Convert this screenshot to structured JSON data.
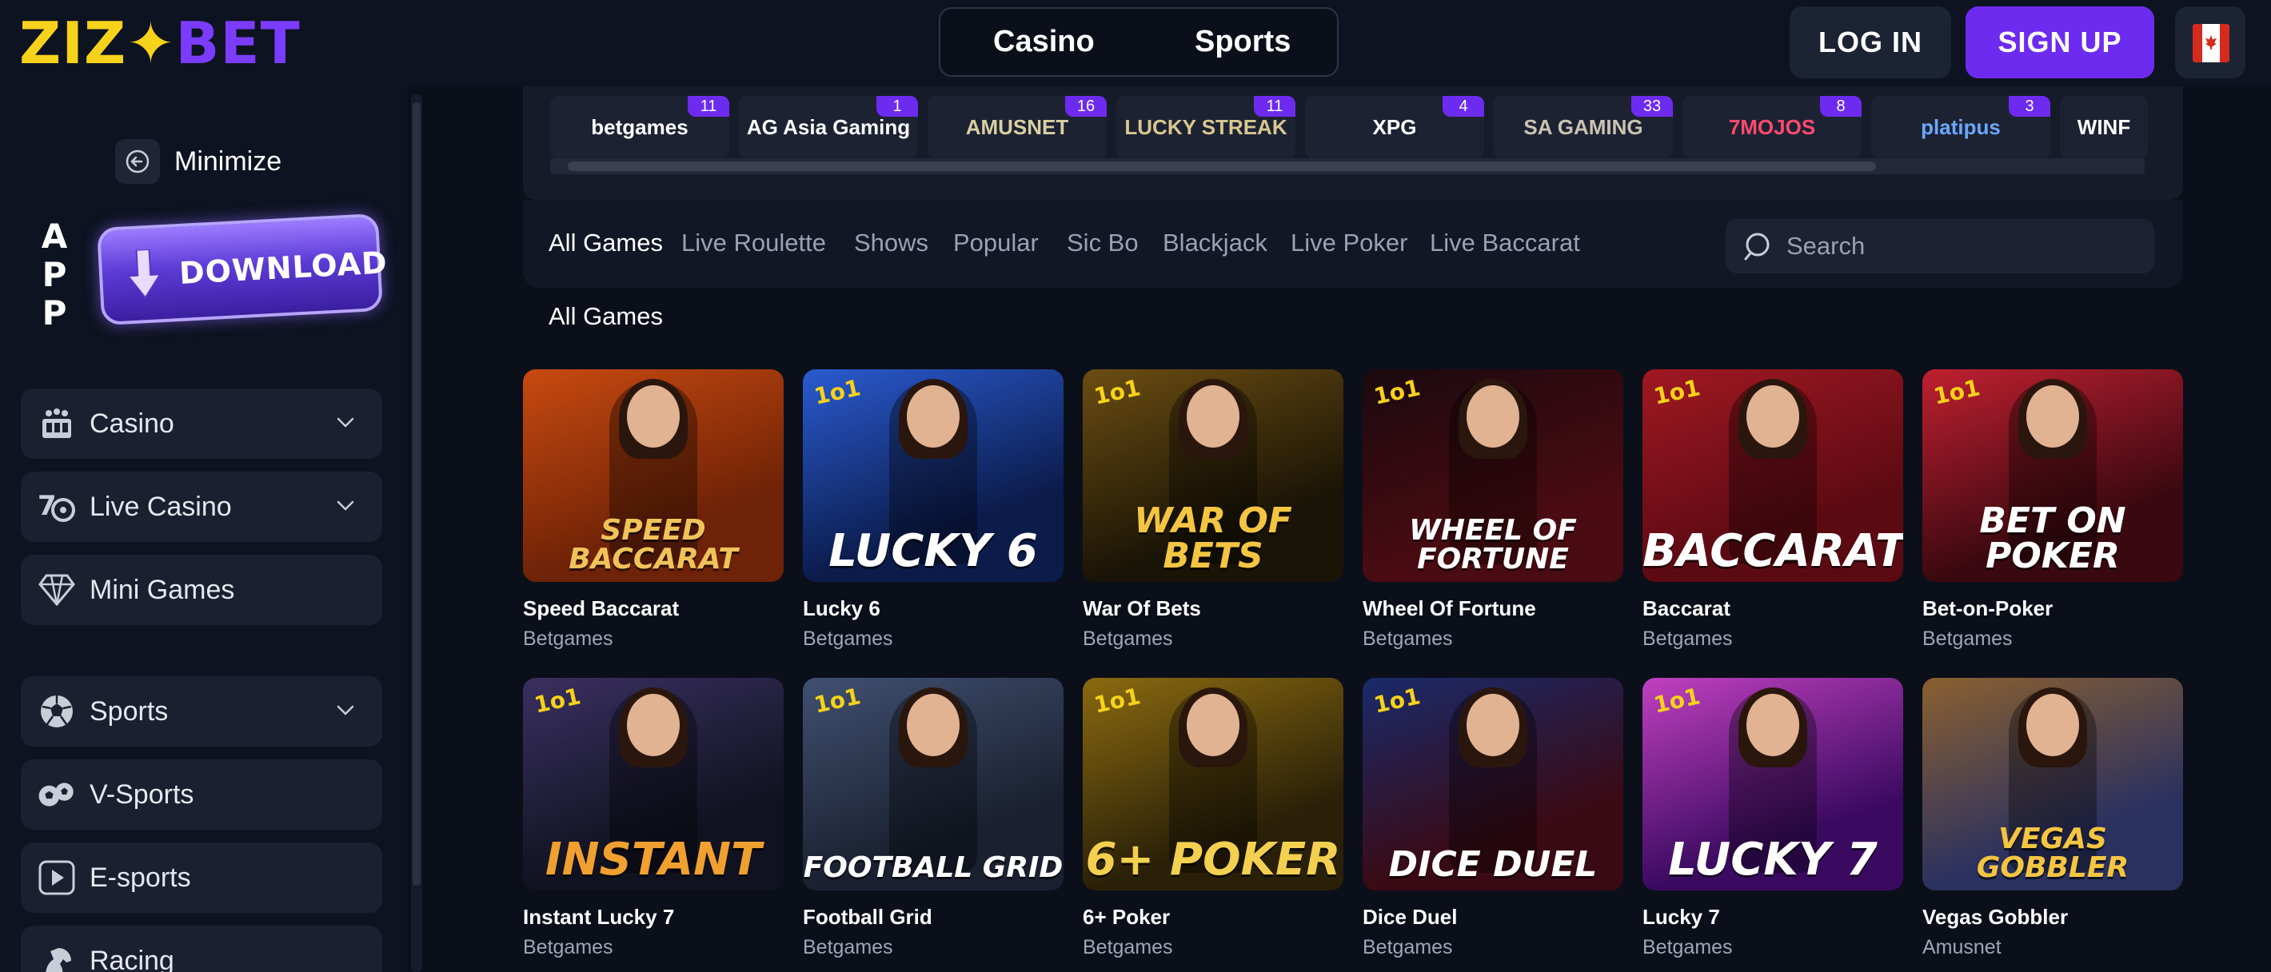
{
  "header": {
    "logo": {
      "part1": "ZIZ",
      "star": "✦",
      "part2": "BET"
    },
    "toggle": {
      "casino": "Casino",
      "sports": "Sports"
    },
    "login": "LOG IN",
    "signup": "SIGN UP",
    "flag_icon": "canada-flag-icon"
  },
  "sidebar": {
    "minimize": "Minimize",
    "app_letters": [
      "A",
      "P",
      "P"
    ],
    "download": "DOWNLOAD",
    "items": [
      {
        "label": "Casino",
        "icon": "casino-icon",
        "has_chevron": true
      },
      {
        "label": "Live Casino",
        "icon": "live-casino-icon",
        "has_chevron": true
      },
      {
        "label": "Mini Games",
        "icon": "diamond-icon",
        "has_chevron": false
      },
      {
        "label": "Sports",
        "icon": "soccer-ball-icon",
        "has_chevron": true
      },
      {
        "label": "V-Sports",
        "icon": "v-sports-icon",
        "has_chevron": false
      },
      {
        "label": "E-sports",
        "icon": "play-icon",
        "has_chevron": false
      },
      {
        "label": "Racing",
        "icon": "horse-icon",
        "has_chevron": false
      }
    ]
  },
  "providers": [
    {
      "name": "betgames",
      "count": "11",
      "color": "#ffffff"
    },
    {
      "name": "AG Asia Gaming",
      "count": "1",
      "color": "#ffffff"
    },
    {
      "name": "AMUSNET",
      "count": "16",
      "color": "#d8d0a0"
    },
    {
      "name": "LUCKY STREAK",
      "count": "11",
      "color": "#d8c890"
    },
    {
      "name": "XPG",
      "count": "4",
      "color": "#ffffff"
    },
    {
      "name": "SA GAMING",
      "count": "33",
      "color": "#c9c4b0"
    },
    {
      "name": "7MOJOS",
      "count": "8",
      "color": "#ff4a6e"
    },
    {
      "name": "platipus",
      "count": "3",
      "color": "#6aa8ff"
    },
    {
      "name": "WINF",
      "count": "",
      "color": "#ffffff"
    }
  ],
  "tabs": [
    "All Games",
    "Live Roulette",
    "Shows",
    "Popular",
    "Sic Bo",
    "Blackjack",
    "Live Poker",
    "Live Baccarat"
  ],
  "search": {
    "placeholder": "Search"
  },
  "section_title": "All Games",
  "games": [
    {
      "title": "Speed Baccarat",
      "provider": "Betgames",
      "art": "SPEED BACCARAT",
      "bg": "#6e2207",
      "bg2": "#c84a10",
      "art_color": "#f0c35a"
    },
    {
      "title": "Lucky 6",
      "provider": "Betgames",
      "art": "LUCKY 6",
      "bg": "#0b1b4a",
      "bg2": "#2a5bd0",
      "art_color": "#ffffff"
    },
    {
      "title": "War Of Bets",
      "provider": "Betgames",
      "art": "WAR OF BETS",
      "bg": "#1a1406",
      "bg2": "#6b4d12",
      "art_color": "#f4c542"
    },
    {
      "title": "Wheel Of Fortune",
      "provider": "Betgames",
      "art": "WHEEL OF FORTUNE",
      "bg": "#4a0b12",
      "bg2": "#1a0a0f",
      "art_color": "#ffffff"
    },
    {
      "title": "Baccarat",
      "provider": "Betgames",
      "art": "BACCARAT",
      "bg": "#5c0a12",
      "bg2": "#a01822",
      "art_color": "#ffffff"
    },
    {
      "title": "Bet-on-Poker",
      "provider": "Betgames",
      "art": "BET ON POKER",
      "bg": "#3a0810",
      "bg2": "#c02030",
      "art_color": "#ffffff"
    },
    {
      "title": "Instant Lucky 7",
      "provider": "Betgames",
      "art": "INSTANT",
      "bg": "#101220",
      "bg2": "#3a3060",
      "art_color": "#f0a030"
    },
    {
      "title": "Football Grid",
      "provider": "Betgames",
      "art": "FOOTBALL GRID",
      "bg": "#1a2030",
      "bg2": "#405070",
      "art_color": "#ffffff"
    },
    {
      "title": "6+ Poker",
      "provider": "Betgames",
      "art": "6+ POKER",
      "bg": "#2a2008",
      "bg2": "#8a6a10",
      "art_color": "#f4d050"
    },
    {
      "title": "Dice Duel",
      "provider": "Betgames",
      "art": "DICE DUEL",
      "bg": "#3a0a14",
      "bg2": "#1a2a6a",
      "art_color": "#ffffff"
    },
    {
      "title": "Lucky 7",
      "provider": "Betgames",
      "art": "LUCKY 7",
      "bg": "#3a0a60",
      "bg2": "#c040c0",
      "art_color": "#ffffff"
    },
    {
      "title": "Vegas Gobbler",
      "provider": "Amusnet",
      "art": "VEGAS GOBBLER",
      "bg": "#2a3060",
      "bg2": "#8a6030",
      "art_color": "#f4c542"
    }
  ],
  "colors": {
    "accent": "#6d2bf0",
    "logo_yellow": "#f6d21b",
    "logo_purple": "#7b3cff",
    "badge": "#6d2bf0"
  }
}
